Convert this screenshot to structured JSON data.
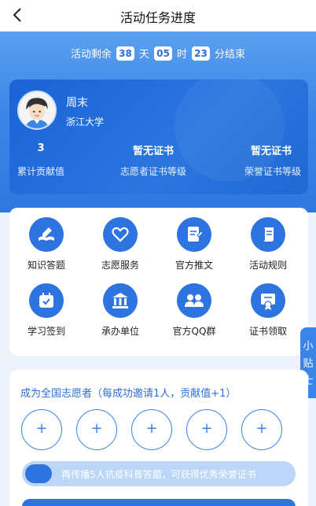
{
  "header": {
    "title": "活动任务进度"
  },
  "countdown": {
    "prefix": "活动剩余",
    "days": "38",
    "day_unit": "天",
    "hours": "05",
    "hour_unit": "时",
    "minutes": "23",
    "suffix": "分结束"
  },
  "profile": {
    "name": "周末",
    "school": "浙江大学",
    "stats": [
      {
        "value": "3",
        "label": "累计贡献值"
      },
      {
        "value": "暂无证书",
        "label": "志愿者证书等级"
      },
      {
        "value": "暂无证书",
        "label": "荣誉证书等级"
      }
    ]
  },
  "grid": [
    {
      "label": "知识答题",
      "icon": "book-pen-icon"
    },
    {
      "label": "志愿服务",
      "icon": "heart-hand-icon"
    },
    {
      "label": "官方推文",
      "icon": "document-edit-icon"
    },
    {
      "label": "活动规则",
      "icon": "scroll-icon"
    },
    {
      "label": "学习签到",
      "icon": "calendar-check-icon"
    },
    {
      "label": "承办单位",
      "icon": "institution-icon"
    },
    {
      "label": "官方QQ群",
      "icon": "group-icon"
    },
    {
      "label": "证书领取",
      "icon": "certificate-icon"
    }
  ],
  "float_tab": {
    "label": "小贴士"
  },
  "invite": {
    "title": "成为全国志愿者（每成功邀请1人，贡献值+1）",
    "slot_symbol": "+",
    "progress_text": "再传播5人抗疫科普答题，可获得优秀荣誉证书",
    "progress_fraction": 0.1
  },
  "colors": {
    "primary": "#2d74e0",
    "hero": "#3c86e8"
  }
}
